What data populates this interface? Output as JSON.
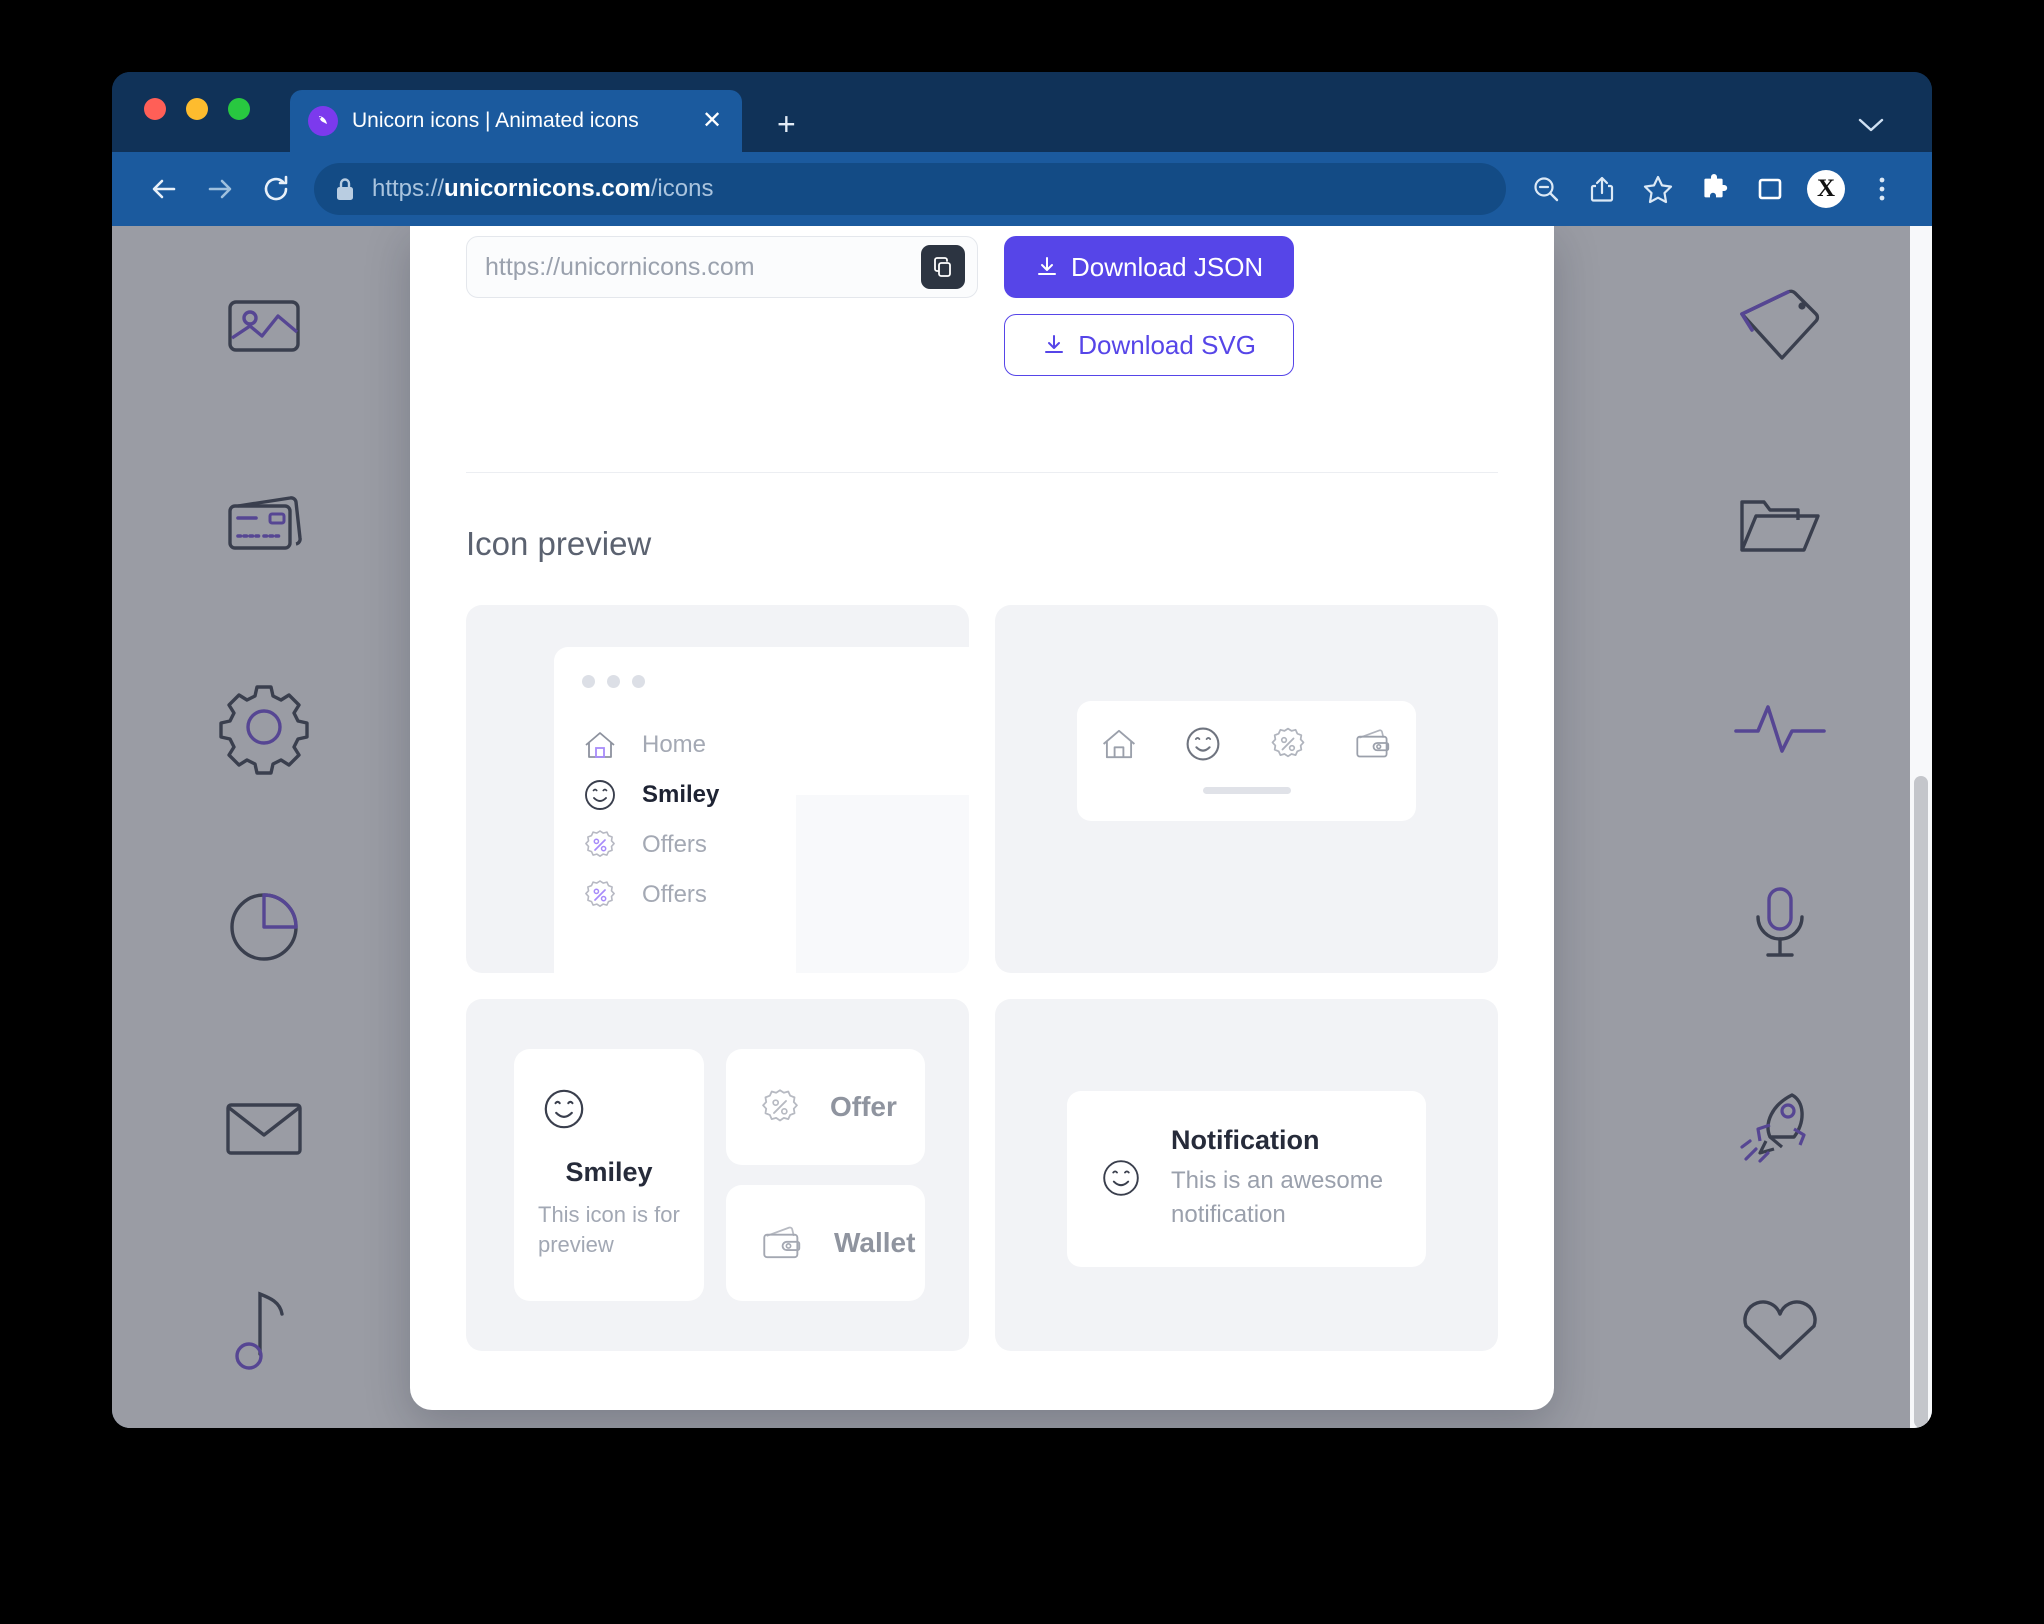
{
  "browser": {
    "tab": {
      "title": "Unicorn icons | Animated icons",
      "favicon": "unicorn-icon",
      "close_label": "✕"
    },
    "newtab_label": "+",
    "toolbar": {
      "back": "back-arrow",
      "forward": "forward-arrow",
      "reload": "reload",
      "url_scheme": "https://",
      "url_domain": "unicornicons.com",
      "url_path": "/icons",
      "avatar_letter": "X",
      "icons": [
        "zoom-out-icon",
        "share-icon",
        "bookmark-star-icon",
        "extensions-puzzle-icon",
        "side-panel-icon",
        "profile-avatar",
        "kebab-menu-icon"
      ]
    }
  },
  "background_icons": {
    "left": [
      "image-icon",
      "credit-card-icon",
      "gear-icon",
      "pie-chart-icon",
      "envelope-icon",
      "music-note-icon"
    ],
    "right": [
      "tag-icon",
      "folder-icon",
      "pulse-icon",
      "microphone-icon",
      "rocket-icon",
      "heart-icon"
    ]
  },
  "modal": {
    "share": {
      "input_placeholder": "https://unicornicons.com",
      "copy_button": "copy-icon"
    },
    "download_json_label": "Download JSON",
    "download_svg_label": "Download SVG",
    "section_title": "Icon preview",
    "preview": {
      "sidebar_card": {
        "items": [
          {
            "label": "Home",
            "icon": "home-icon",
            "active": false
          },
          {
            "label": "Smiley",
            "icon": "smiley-icon",
            "active": true
          },
          {
            "label": "Offers",
            "icon": "offer-badge-icon",
            "active": false
          },
          {
            "label": "Offers",
            "icon": "offer-badge-icon",
            "active": false
          }
        ]
      },
      "phonebar_card": {
        "icons": [
          "home-icon",
          "smiley-icon",
          "offer-badge-icon",
          "wallet-icon"
        ]
      },
      "tiles_card": {
        "main_tile": {
          "icon": "smiley-icon",
          "name": "Smiley",
          "subtitle": "This icon is for preview"
        },
        "rows": [
          {
            "icon": "offer-badge-icon",
            "label": "Offer"
          },
          {
            "icon": "wallet-icon",
            "label": "Wallet"
          }
        ]
      },
      "notification_card": {
        "icon": "smiley-icon",
        "title": "Notification",
        "text": "This is an awesome notification"
      }
    }
  },
  "colors": {
    "accent": "#5645e8",
    "browser_chrome": "#1b5a9e",
    "tabstrip": "#103258",
    "icon_purple": "#7c5cdb",
    "icon_grey": "#4a4f5e"
  }
}
